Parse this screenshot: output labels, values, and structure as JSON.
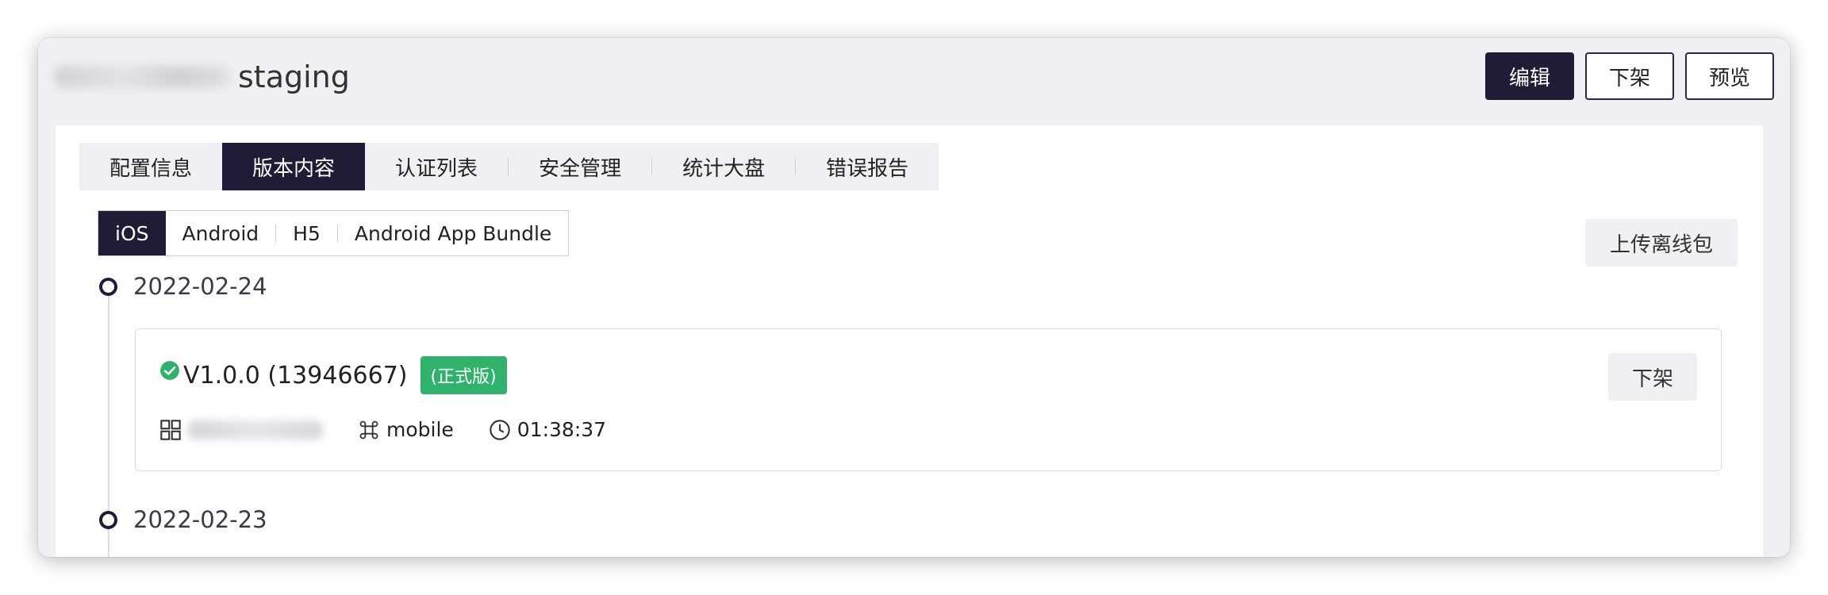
{
  "header": {
    "title_suffix": "staging",
    "buttons": {
      "edit": "编辑",
      "unpublish": "下架",
      "preview": "预览"
    }
  },
  "tabs": [
    "配置信息",
    "版本内容",
    "认证列表",
    "安全管理",
    "统计大盘",
    "错误报告"
  ],
  "active_tab": "版本内容",
  "platforms": [
    "iOS",
    "Android",
    "H5",
    "Android App Bundle"
  ],
  "active_platform": "iOS",
  "upload_button": "上传离线包",
  "timeline": [
    {
      "date": "2022-02-24",
      "release": {
        "version": "V1.0.0 (13946667)",
        "badge": "(正式版)",
        "action": "下架",
        "tag": "mobile",
        "time": "01:38:37"
      }
    },
    {
      "date": "2022-02-23"
    }
  ],
  "icons": {
    "status": "check-circle-icon",
    "app": "grid-icon",
    "tag": "command-icon",
    "time": "clock-icon"
  },
  "colors": {
    "primary": "#1f1c36",
    "success": "#2fb36a",
    "background": "#f0f0f4"
  }
}
